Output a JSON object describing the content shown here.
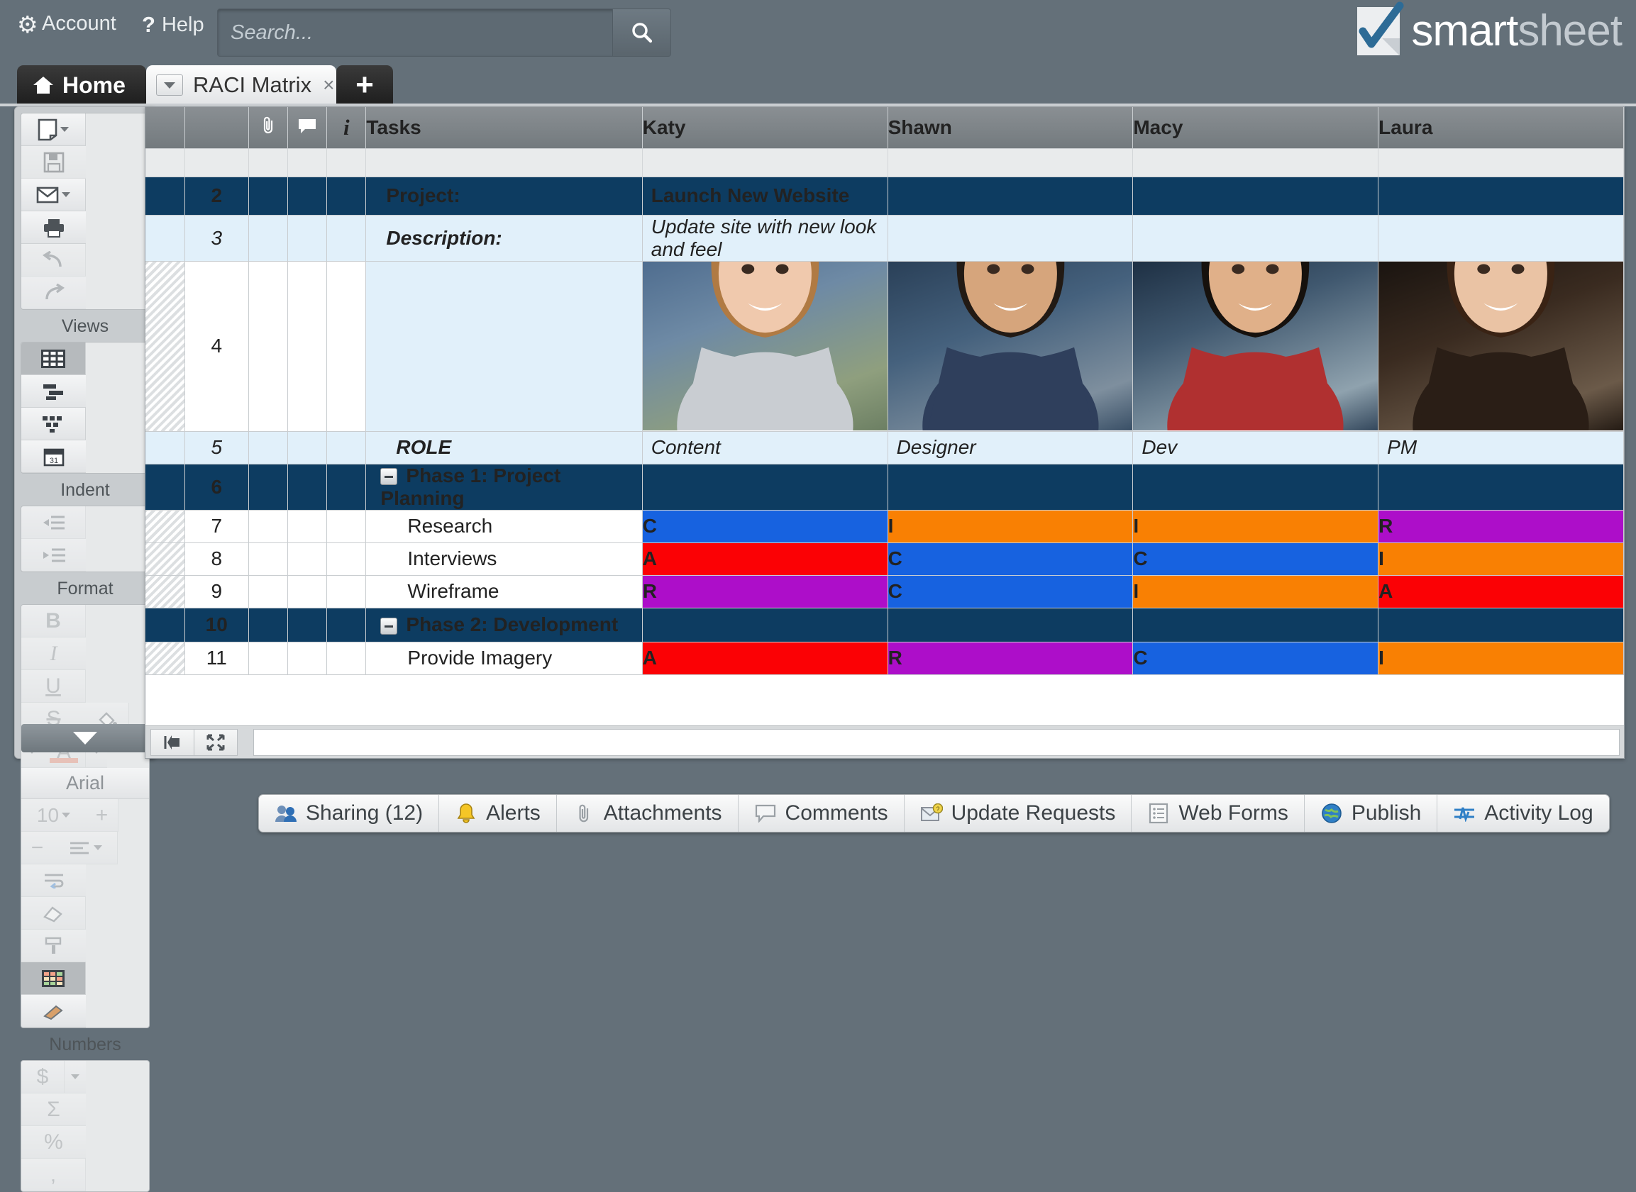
{
  "topbar": {
    "account_label": "Account",
    "help_label": "Help",
    "search_placeholder": "Search...",
    "search_value": "",
    "logo_part1": "smart",
    "logo_part2": "sheet"
  },
  "tabs": {
    "home_label": "Home",
    "sheet_label": "RACI Matrix",
    "close_glyph": "×",
    "add_glyph": "+"
  },
  "toolbar": {
    "groups": [
      {
        "label": "",
        "buttons": [
          "new-sheet",
          "save",
          "send-email",
          "print",
          "undo",
          "redo"
        ]
      },
      {
        "label": "Views",
        "buttons": [
          "grid-view",
          "gantt-view",
          "card-view",
          "calendar-view"
        ]
      },
      {
        "label": "Indent",
        "buttons": [
          "outdent",
          "indent"
        ]
      },
      {
        "label": "Format",
        "buttons": [
          "bold",
          "italic",
          "underline",
          "strikethrough",
          "fill-color",
          "text-color"
        ]
      }
    ],
    "views_label": "Views",
    "indent_label": "Indent",
    "format_label": "Format",
    "numbers_label": "Numbers",
    "bold_glyph": "B",
    "italic_glyph": "I",
    "underline_glyph": "U",
    "strike_glyph": "S",
    "font_name": "Arial",
    "font_size": "10",
    "plus_glyph": "+",
    "minus_glyph": "−",
    "currency_glyph": "$",
    "sigma_glyph": "Σ",
    "percent_glyph": "%",
    "comma_glyph": "‚",
    "fill_swatch": "#f7e4bd",
    "textcolor_swatch": "#e98b74"
  },
  "sheet": {
    "columns": [
      {
        "key": "hatch",
        "label": ""
      },
      {
        "key": "rownum",
        "label": ""
      },
      {
        "key": "attachment",
        "label": "attachment-icon"
      },
      {
        "key": "comment",
        "label": "comment-icon"
      },
      {
        "key": "info",
        "label": "info-icon"
      },
      {
        "key": "tasks",
        "label": "Tasks"
      },
      {
        "key": "katy",
        "label": "Katy"
      },
      {
        "key": "shawn",
        "label": "Shawn"
      },
      {
        "key": "macy",
        "label": "Macy"
      },
      {
        "key": "laura",
        "label": "Laura"
      }
    ],
    "people": [
      "Katy",
      "Shawn",
      "Macy",
      "Laura"
    ],
    "rows": [
      {
        "num": "2",
        "type": "project",
        "label": "Project:",
        "values": [
          "Launch New Website",
          "",
          "",
          ""
        ]
      },
      {
        "num": "3",
        "type": "description",
        "label": "Description:",
        "values": [
          "Update site with new look and feel",
          "",
          "",
          ""
        ]
      },
      {
        "num": "4",
        "type": "photos",
        "label": "",
        "values": [
          "",
          "",
          "",
          ""
        ]
      },
      {
        "num": "5",
        "type": "role",
        "label": "ROLE",
        "values": [
          "Content",
          "Designer",
          "Dev",
          "PM"
        ]
      },
      {
        "num": "6",
        "type": "phase",
        "label": "Phase 1: Project Planning",
        "values": [
          "",
          "",
          "",
          ""
        ]
      },
      {
        "num": "7",
        "type": "task",
        "label": "Research",
        "values": [
          "C",
          "I",
          "I",
          "R"
        ]
      },
      {
        "num": "8",
        "type": "task",
        "label": "Interviews",
        "values": [
          "A",
          "C",
          "C",
          "I"
        ]
      },
      {
        "num": "9",
        "type": "task",
        "label": "Wireframe",
        "values": [
          "R",
          "C",
          "I",
          "A"
        ]
      },
      {
        "num": "10",
        "type": "phase",
        "label": "Phase 2: Development",
        "values": [
          "",
          "",
          "",
          ""
        ]
      },
      {
        "num": "11",
        "type": "task",
        "label": "Provide Imagery",
        "values": [
          "A",
          "R",
          "C",
          "I"
        ]
      }
    ],
    "raci_colors": {
      "R": "#ad0ec9",
      "A": "#fb0105",
      "C": "#1762e0",
      "I": "#f98003"
    },
    "header_bg": "#7c8286",
    "project_bg": "#0d3c61",
    "description_bg": "#e1f0fa"
  },
  "bottom_tabs": [
    {
      "label": "Sharing (12)",
      "icon": "people-icon"
    },
    {
      "label": "Alerts",
      "icon": "bell-icon"
    },
    {
      "label": "Attachments",
      "icon": "paperclip-icon"
    },
    {
      "label": "Comments",
      "icon": "comment-icon"
    },
    {
      "label": "Update Requests",
      "icon": "update-request-icon"
    },
    {
      "label": "Web Forms",
      "icon": "form-icon"
    },
    {
      "label": "Publish",
      "icon": "globe-icon"
    },
    {
      "label": "Activity Log",
      "icon": "activity-icon"
    }
  ]
}
